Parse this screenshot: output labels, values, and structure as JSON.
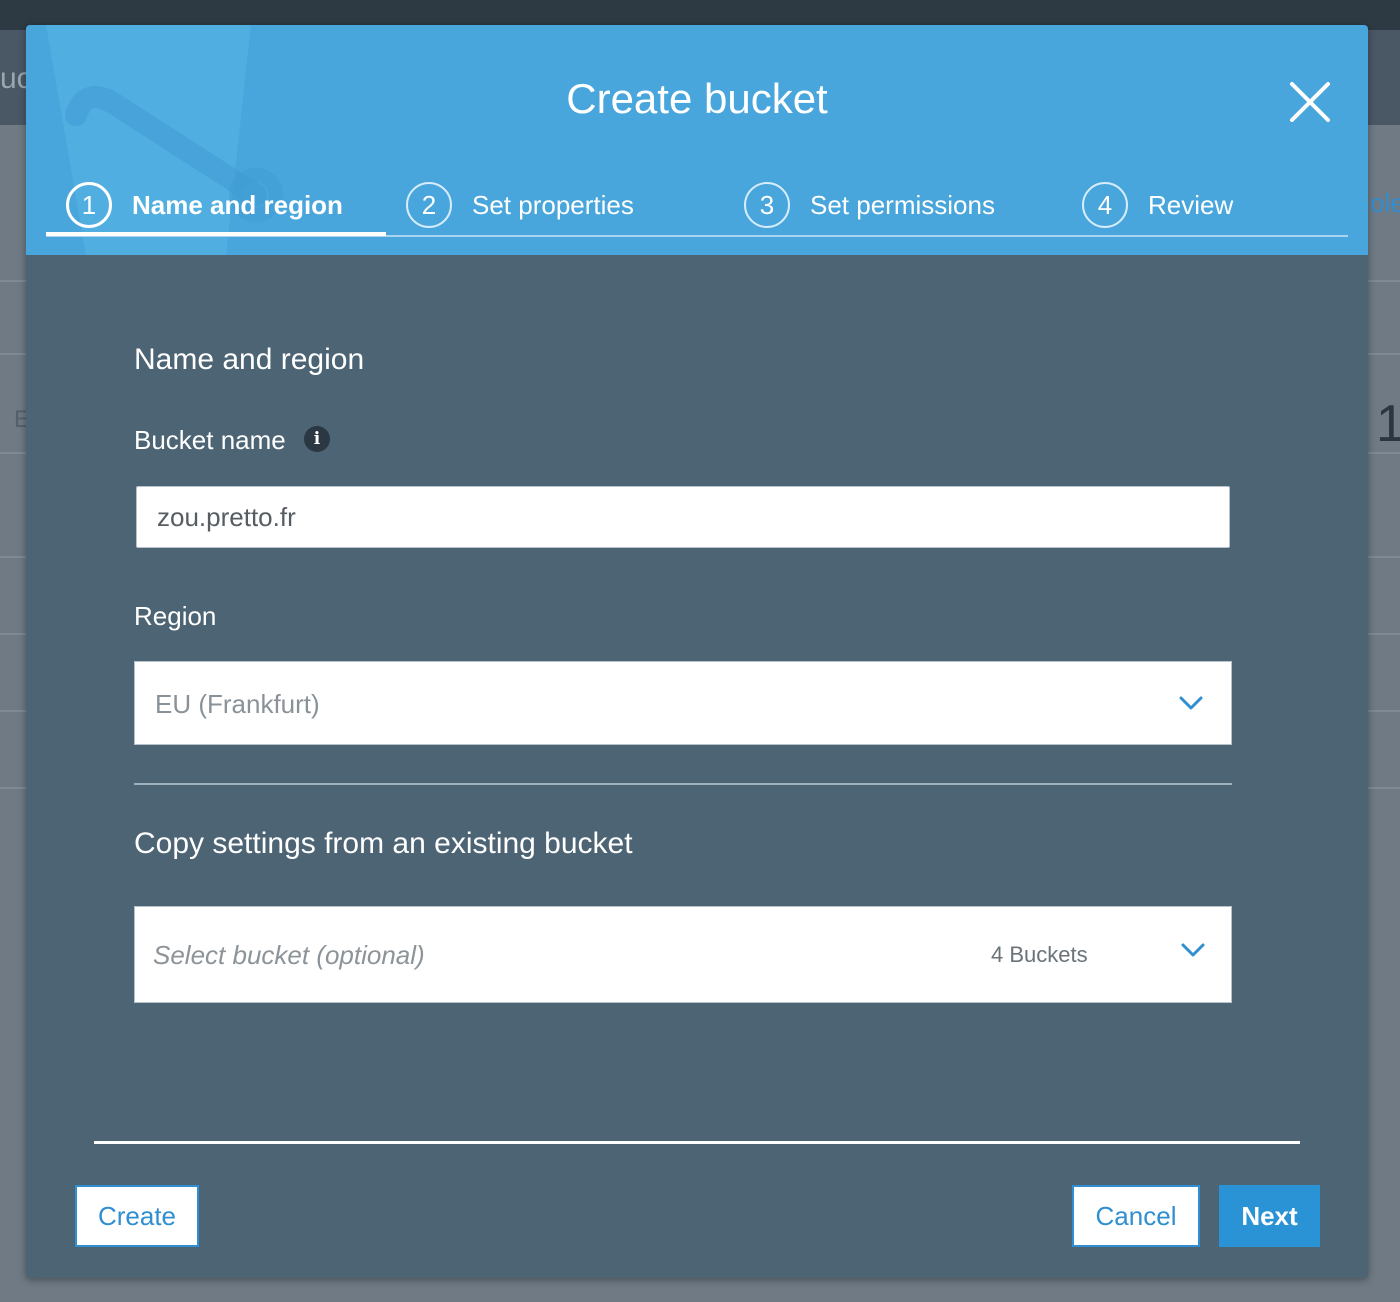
{
  "background": {
    "left_fragment": "uc",
    "right_fragment": "ole",
    "right_digit": "1",
    "left_letter": "E"
  },
  "modal": {
    "title": "Create bucket",
    "close_icon": "close-icon",
    "steps": [
      {
        "number": "1",
        "label": "Name and region",
        "active": true
      },
      {
        "number": "2",
        "label": "Set properties",
        "active": false
      },
      {
        "number": "3",
        "label": "Set permissions",
        "active": false
      },
      {
        "number": "4",
        "label": "Review",
        "active": false
      }
    ],
    "section_title": "Name and region",
    "bucket_name": {
      "label": "Bucket name",
      "info_icon": "info-icon",
      "value": "zou.pretto.fr"
    },
    "region": {
      "label": "Region",
      "value": "EU (Frankfurt)"
    },
    "copy_settings": {
      "title": "Copy settings from an existing bucket",
      "placeholder": "Select bucket (optional)",
      "count": "4 Buckets"
    },
    "buttons": {
      "create": "Create",
      "cancel": "Cancel",
      "next": "Next"
    }
  },
  "colors": {
    "header_blue": "#48a6dc",
    "body_slate": "#4d6474",
    "accent_blue": "#2a93d5"
  }
}
